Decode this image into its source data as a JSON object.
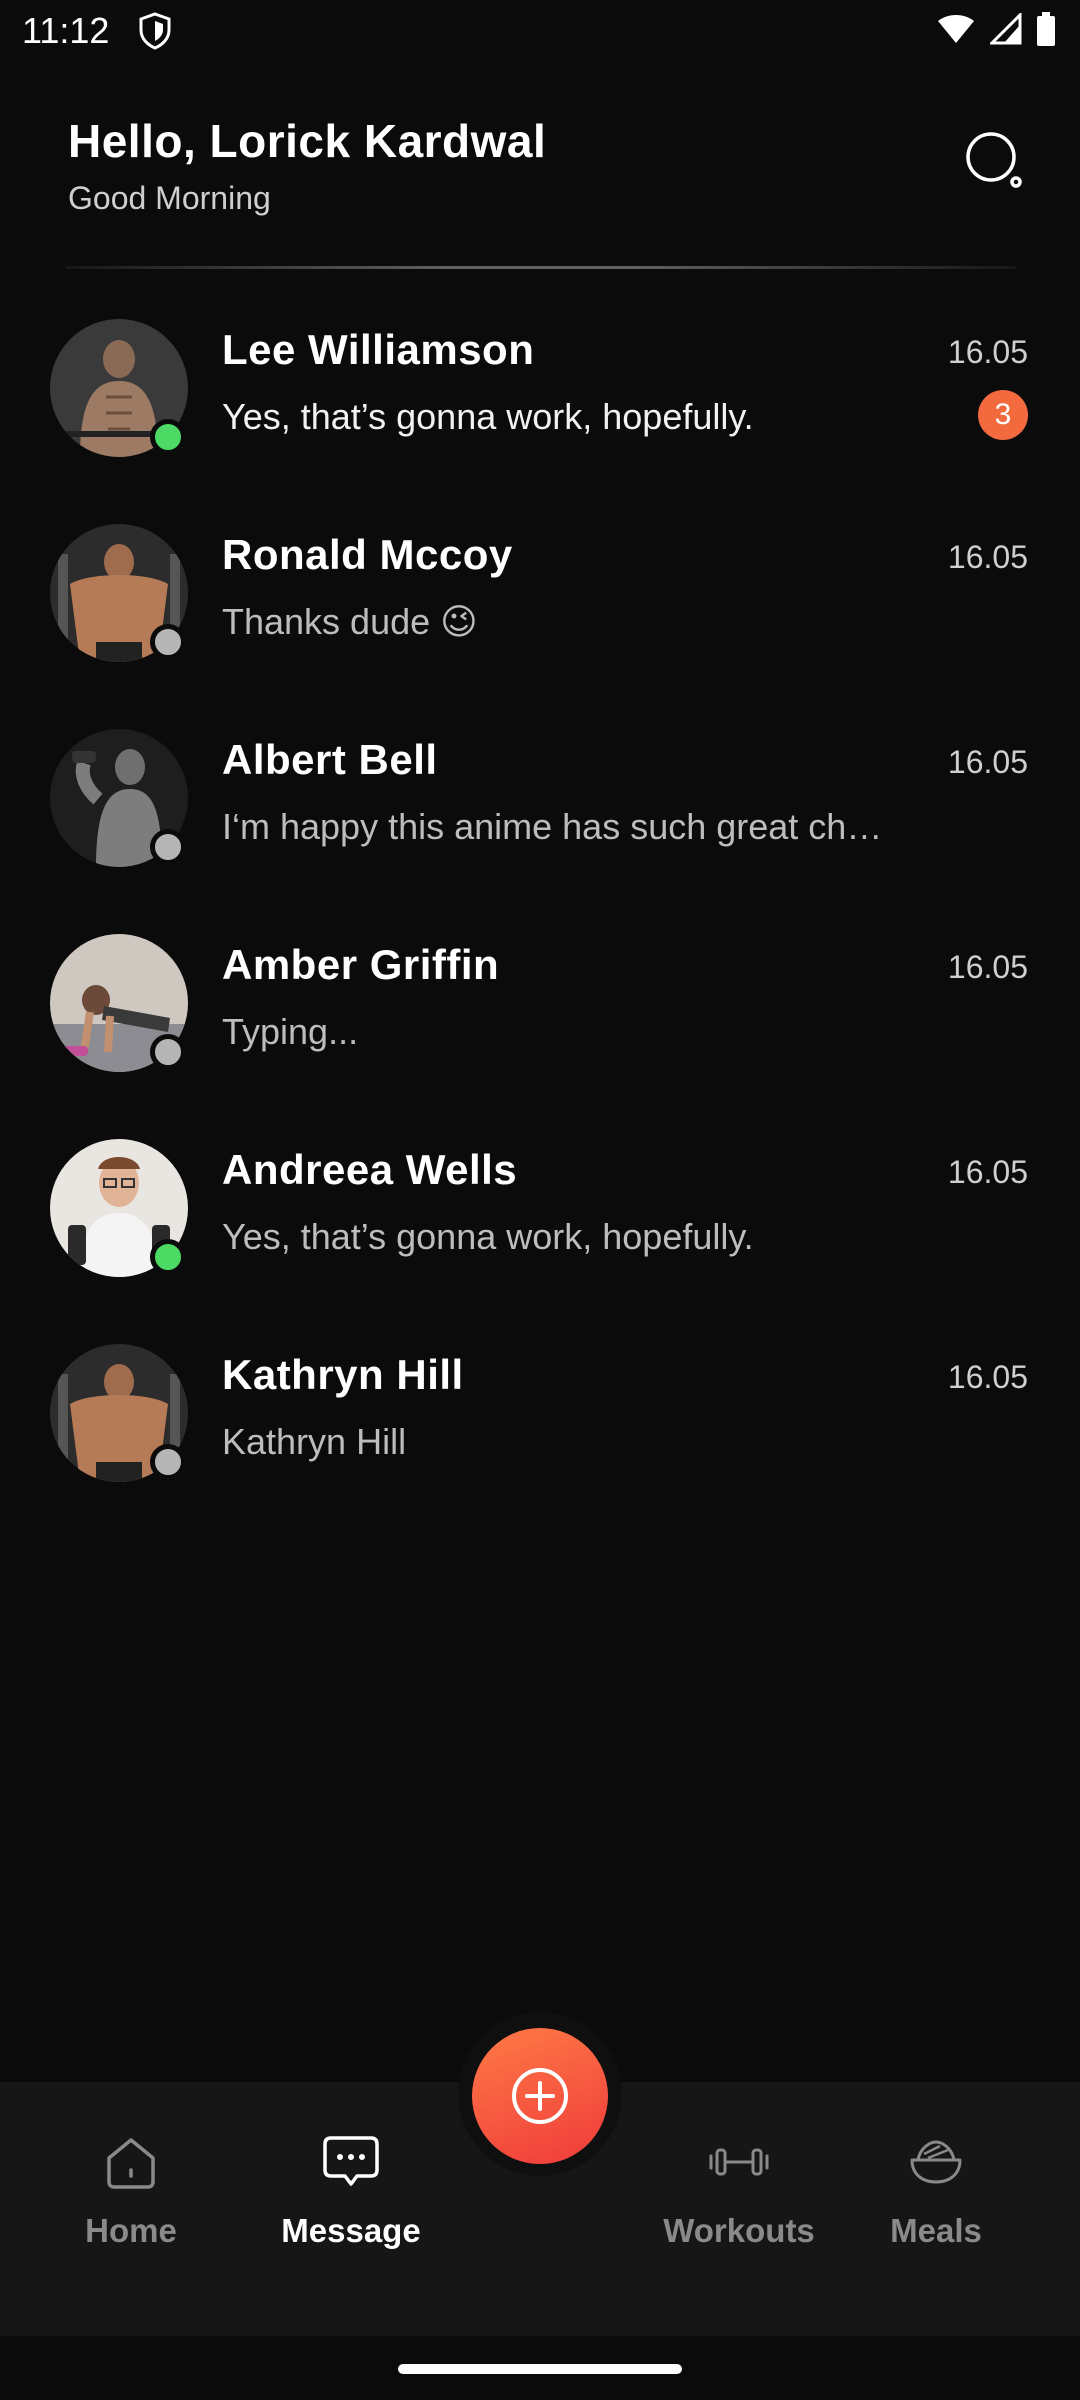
{
  "status_bar": {
    "time": "11:12"
  },
  "header": {
    "title": "Hello, Lorick Kardwal",
    "subtitle": "Good Morning"
  },
  "chats": [
    {
      "name": "Lee Williamson",
      "time": "16.05",
      "preview": "Yes, that’s gonna work, hopefully.",
      "unread": "3",
      "online": true
    },
    {
      "name": "Ronald Mccoy",
      "time": "16.05",
      "preview": "Thanks dude 😉",
      "unread": "",
      "online": false
    },
    {
      "name": "Albert Bell",
      "time": "16.05",
      "preview": "I‘m happy this anime has such great characters",
      "unread": "",
      "online": false
    },
    {
      "name": "Amber Griffin",
      "time": "16.05",
      "preview": "Typing...",
      "unread": "",
      "online": false
    },
    {
      "name": "Andreea Wells",
      "time": "16.05",
      "preview": "Yes, that’s gonna work, hopefully.",
      "unread": "",
      "online": true
    },
    {
      "name": "Kathryn Hill",
      "time": "16.05",
      "preview": "Kathryn Hill",
      "unread": "",
      "online": false
    }
  ],
  "nav": {
    "home": "Home",
    "message": "Message",
    "workouts": "Workouts",
    "meals": "Meals"
  },
  "colors": {
    "online": "#4cd964",
    "offline": "#b5b5b5",
    "accent": "#f26a3e",
    "background": "#0b0b0b"
  },
  "icons": {
    "search": "search-icon",
    "add": "plus-circle-icon",
    "home": "home-icon",
    "message": "chat-bubble-icon",
    "workouts": "dumbbell-icon",
    "meals": "bowl-icon"
  }
}
